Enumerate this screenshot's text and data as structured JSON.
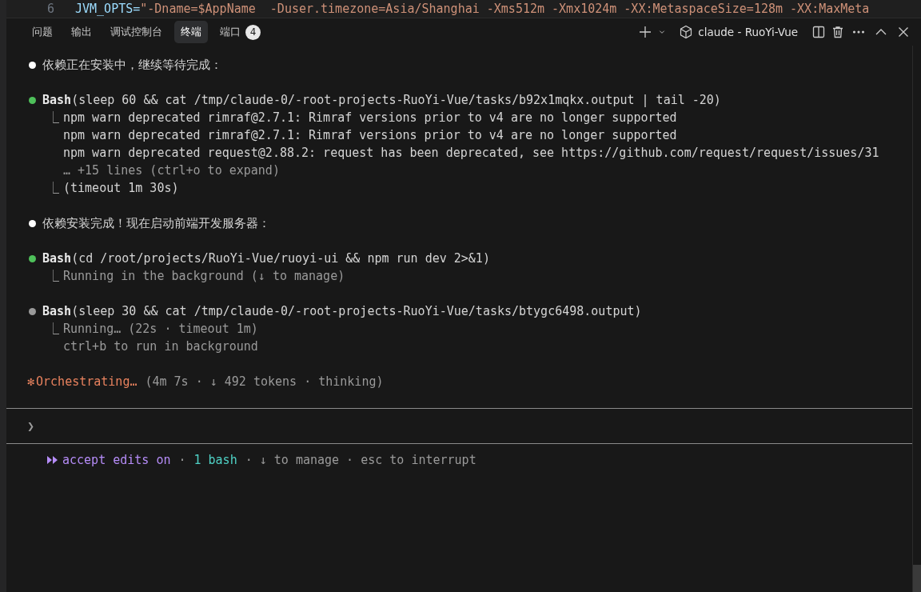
{
  "editor": {
    "line_number": "6",
    "segments": [
      {
        "text": "JVM_OPTS=",
        "kind": "variable"
      },
      {
        "text": "\"-Dname=$AppName  -Duser.timezone=Asia/Shanghai -Xms512m -Xmx1024m -XX:MetaspaceSize=128m -XX:MaxMeta",
        "kind": "string"
      }
    ]
  },
  "panel": {
    "tabs": [
      {
        "label": "问题",
        "selected": false
      },
      {
        "label": "输出",
        "selected": false
      },
      {
        "label": "调试控制台",
        "selected": false
      },
      {
        "label": "终端",
        "selected": true
      },
      {
        "label": "端口",
        "selected": false,
        "badge": "4"
      }
    ],
    "terminal_title": "claude - RuoYi-Vue"
  },
  "terminal": {
    "entries": [
      {
        "kind": "message",
        "color": "#ffffff",
        "text": "依赖正在安装中，继续等待完成："
      },
      {
        "kind": "tool",
        "color": "#4ec05a",
        "command": "**Bash**(sleep 60 && cat /tmp/claude-0/-root-projects-RuoYi-Vue/tasks/b92x1mqkx.output | tail -20)",
        "results": [
          {
            "marker": "⎿",
            "lines": [
              {
                "text": "npm warn deprecated rimraf@2.7.1: Rimraf versions prior to v4 are no longer supported",
                "dim": false
              },
              {
                "text": "npm warn deprecated rimraf@2.7.1: Rimraf versions prior to v4 are no longer supported",
                "dim": false
              },
              {
                "text": "npm warn deprecated request@2.88.2: request has been deprecated, see https://github.com/request/request/issues/31",
                "dim": false
              },
              {
                "text": "… +15 lines (ctrl+o to expand)",
                "dim": true
              }
            ]
          },
          {
            "marker": "⎿",
            "lines": [
              {
                "text": "(timeout 1m 30s)",
                "dim": false
              }
            ]
          }
        ]
      },
      {
        "kind": "message",
        "color": "#ffffff",
        "text": "依赖安装完成！现在启动前端开发服务器："
      },
      {
        "kind": "tool",
        "color": "#4ec05a",
        "command": "**Bash**(cd /root/projects/RuoYi-Vue/ruoyi-ui && npm run dev 2>&1)",
        "results": [
          {
            "marker": "⎿",
            "lines": [
              {
                "text": "Running in the background (↓ to manage)",
                "dim": true
              }
            ]
          }
        ]
      },
      {
        "kind": "tool",
        "color": "#9a9a9a",
        "command": "**Bash**(sleep 30 && cat /tmp/claude-0/-root-projects-RuoYi-Vue/tasks/btygc6498.output)",
        "results": [
          {
            "marker": "⎿",
            "lines": [
              {
                "text": "Running… (22s · timeout 1m)",
                "dim": true
              },
              {
                "text": "ctrl+b to run in background",
                "dim": true
              }
            ]
          }
        ]
      },
      {
        "kind": "status",
        "spinner": "✻",
        "verb": "Orchestrating…",
        "detail": "(4m 7s · ↓ 492 tokens · thinking)"
      }
    ],
    "prompt": "❯",
    "footer": [
      {
        "text": "accept edits on",
        "kind": "mode"
      },
      {
        "text": "·",
        "kind": "dim"
      },
      {
        "text": "1 bash",
        "kind": "bash"
      },
      {
        "text": "· ↓ to manage · esc to interrupt",
        "kind": "dim"
      }
    ]
  }
}
